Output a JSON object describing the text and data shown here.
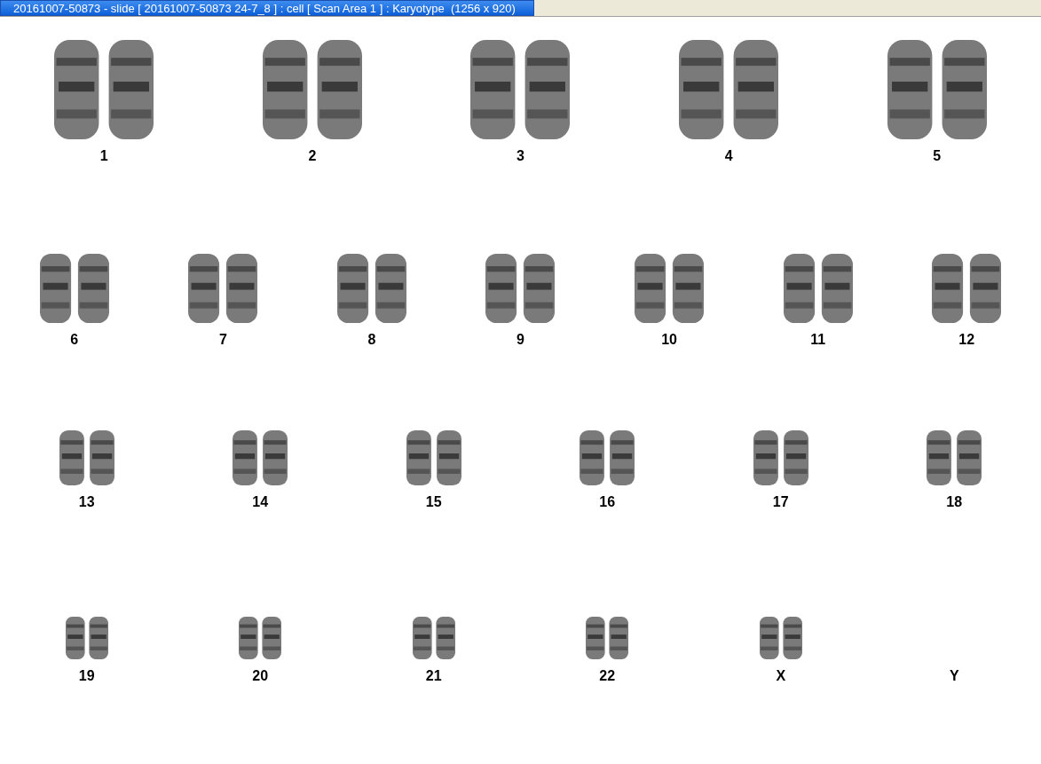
{
  "window": {
    "title": "20161007-50873 - slide [ 20161007-50873 24-7_8 ] : cell [ Scan Area 1 ] : Karyotype  (1256 x 920)"
  },
  "karyotype": {
    "rows": [
      {
        "pairs": [
          {
            "label": "1",
            "empty": false
          },
          {
            "label": "2",
            "empty": false
          },
          {
            "label": "3",
            "empty": false
          },
          {
            "label": "4",
            "empty": false
          },
          {
            "label": "5",
            "empty": false
          }
        ]
      },
      {
        "pairs": [
          {
            "label": "6",
            "empty": false
          },
          {
            "label": "7",
            "empty": false
          },
          {
            "label": "8",
            "empty": false
          },
          {
            "label": "9",
            "empty": false
          },
          {
            "label": "10",
            "empty": false
          },
          {
            "label": "11",
            "empty": false
          },
          {
            "label": "12",
            "empty": false
          }
        ]
      },
      {
        "pairs": [
          {
            "label": "13",
            "empty": false
          },
          {
            "label": "14",
            "empty": false
          },
          {
            "label": "15",
            "empty": false
          },
          {
            "label": "16",
            "empty": false
          },
          {
            "label": "17",
            "empty": false
          },
          {
            "label": "18",
            "empty": false
          }
        ]
      },
      {
        "pairs": [
          {
            "label": "19",
            "empty": false
          },
          {
            "label": "20",
            "empty": false
          },
          {
            "label": "21",
            "empty": false
          },
          {
            "label": "22",
            "empty": false
          },
          {
            "label": "X",
            "empty": false
          },
          {
            "label": "Y",
            "empty": true
          }
        ]
      }
    ]
  }
}
